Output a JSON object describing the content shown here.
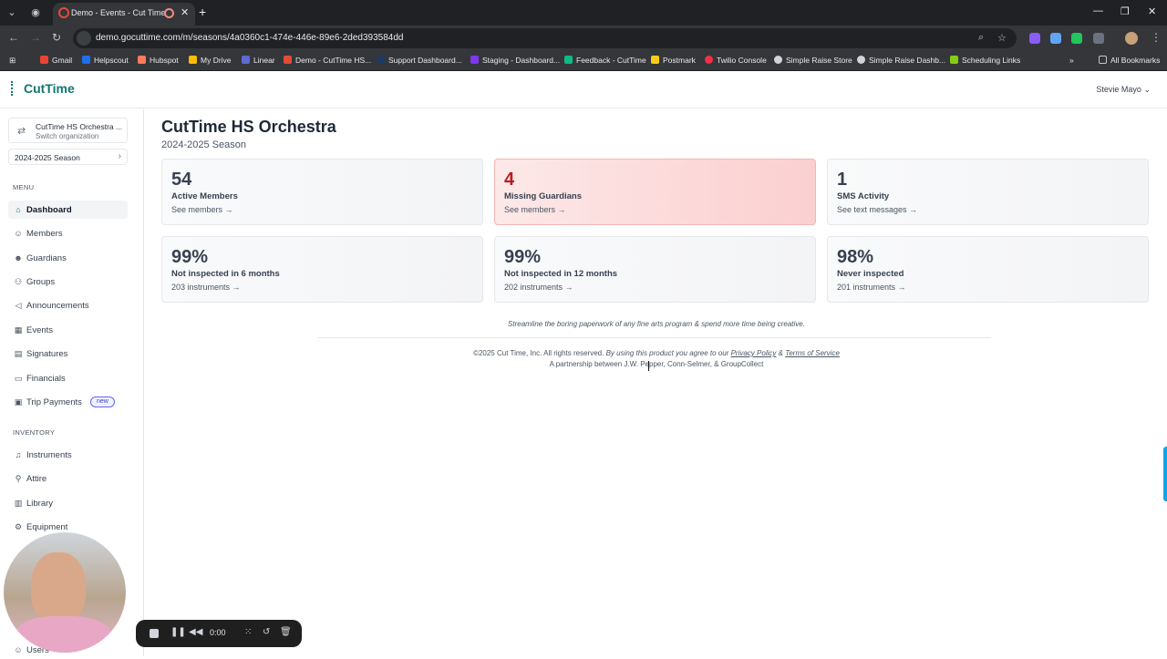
{
  "browser": {
    "tab_title": "Demo - Events - Cut Time",
    "url": "demo.gocuttime.com/m/seasons/4a0360c1-474e-446e-89e6-2ded393584dd",
    "bookmarks": [
      "Gmail",
      "Helpscout",
      "Hubspot",
      "My Drive",
      "Linear",
      "Demo - CutTime HS...",
      "Support Dashboard...",
      "Staging - Dashboard...",
      "Feedback - CutTime",
      "Postmark",
      "Twilio Console",
      "Simple Raise Store",
      "Simple Raise Dashb...",
      "Scheduling Links"
    ],
    "all_bookmarks": "All Bookmarks"
  },
  "header": {
    "logo": "CutTime",
    "user": "Stevie Mayo"
  },
  "sidebar": {
    "org_name": "CutTime HS Orchestra ...",
    "org_sub": "Switch organization",
    "season": "2024-2025 Season",
    "menu_label": "MENU",
    "menu": [
      {
        "label": "Dashboard",
        "icon": "home-icon"
      },
      {
        "label": "Members",
        "icon": "users-icon"
      },
      {
        "label": "Guardians",
        "icon": "guardians-icon"
      },
      {
        "label": "Groups",
        "icon": "groups-icon"
      },
      {
        "label": "Announcements",
        "icon": "megaphone-icon"
      },
      {
        "label": "Events",
        "icon": "calendar-icon"
      },
      {
        "label": "Signatures",
        "icon": "signature-icon"
      },
      {
        "label": "Financials",
        "icon": "financials-icon"
      },
      {
        "label": "Trip Payments",
        "icon": "trip-icon",
        "badge": "new"
      }
    ],
    "inventory_label": "INVENTORY",
    "inventory": [
      {
        "label": "Instruments",
        "icon": "instrument-icon"
      },
      {
        "label": "Attire",
        "icon": "attire-icon"
      },
      {
        "label": "Library",
        "icon": "library-icon"
      },
      {
        "label": "Equipment",
        "icon": "equipment-icon"
      }
    ],
    "bottom_item": "Users"
  },
  "main": {
    "title": "CutTime HS Orchestra",
    "subtitle": "2024-2025 Season",
    "cards": [
      {
        "value": "54",
        "caption": "Active Members",
        "link": "See members →"
      },
      {
        "value": "4",
        "caption": "Missing Guardians",
        "link": "See members →"
      },
      {
        "value": "1",
        "caption": "SMS Activity",
        "link": "See text messages →"
      },
      {
        "value": "99%",
        "caption": "Not inspected in 6 months",
        "link": "203 instruments →"
      },
      {
        "value": "99%",
        "caption": "Not inspected in 12 months",
        "link": "202 instruments →"
      },
      {
        "value": "98%",
        "caption": "Never inspected",
        "link": "201 instruments →"
      }
    ],
    "tagline": "Streamline the boring paperwork of any fine arts program & spend more time being creative.",
    "footer": {
      "copyright": "©2025 Cut Time, Inc. All rights reserved.",
      "agree": "By using this product you agree to our",
      "privacy": "Privacy Policy",
      "amp": "&",
      "terms": "Terms of Service",
      "partnership": "A partnership between J.W. Pepper, Conn-Selmer, & GroupCollect"
    }
  },
  "recorder": {
    "time": "0:00"
  },
  "colors": {
    "brand": "#0f766e",
    "alert_bg": "#fbcfcf",
    "alert_text": "#b91c1c"
  }
}
